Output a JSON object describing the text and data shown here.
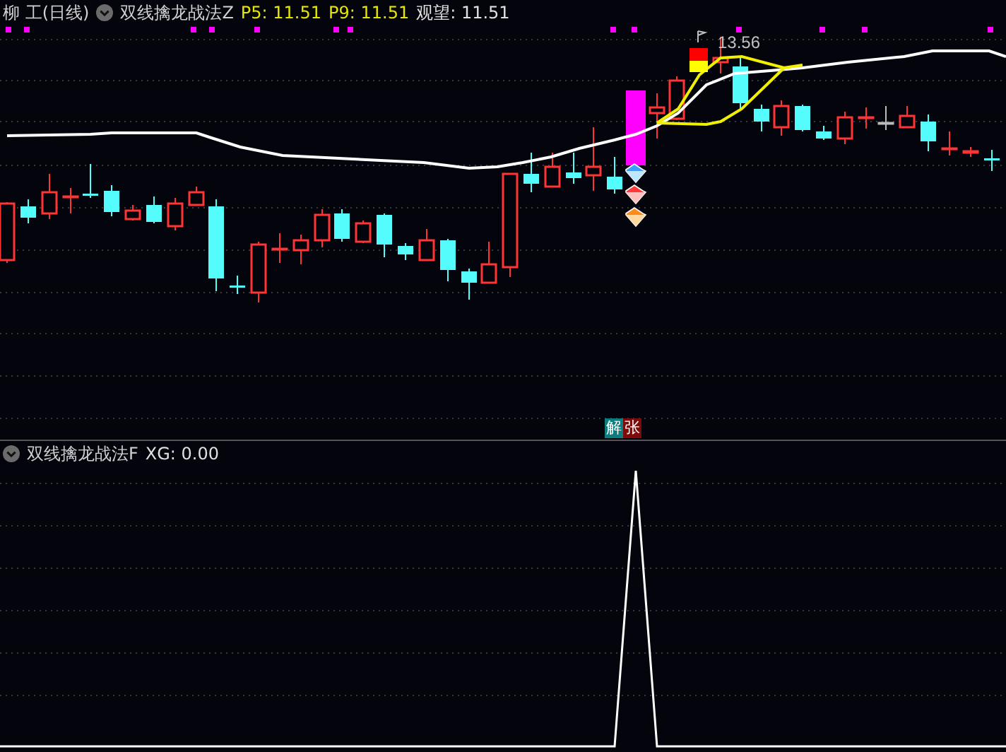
{
  "main_panel": {
    "security": "柳 工(日线)",
    "indicator": "双线擒龙战法Z",
    "values": [
      {
        "label": "P5: 11.51",
        "color": "#e6e600"
      },
      {
        "label": "P9: 11.51",
        "color": "#e6e600"
      },
      {
        "label": "观望: 11.51",
        "color": "#e0e0e0"
      }
    ],
    "high_label": "13.56",
    "badges": [
      {
        "text": "解",
        "color": "#0b7f7f"
      },
      {
        "text": "张",
        "color": "#7f0a0a"
      }
    ]
  },
  "sub_panel": {
    "indicator": "双线擒龙战法F",
    "values": [
      {
        "label": "XG: 0.00",
        "color": "#e0e0e0"
      }
    ]
  }
}
